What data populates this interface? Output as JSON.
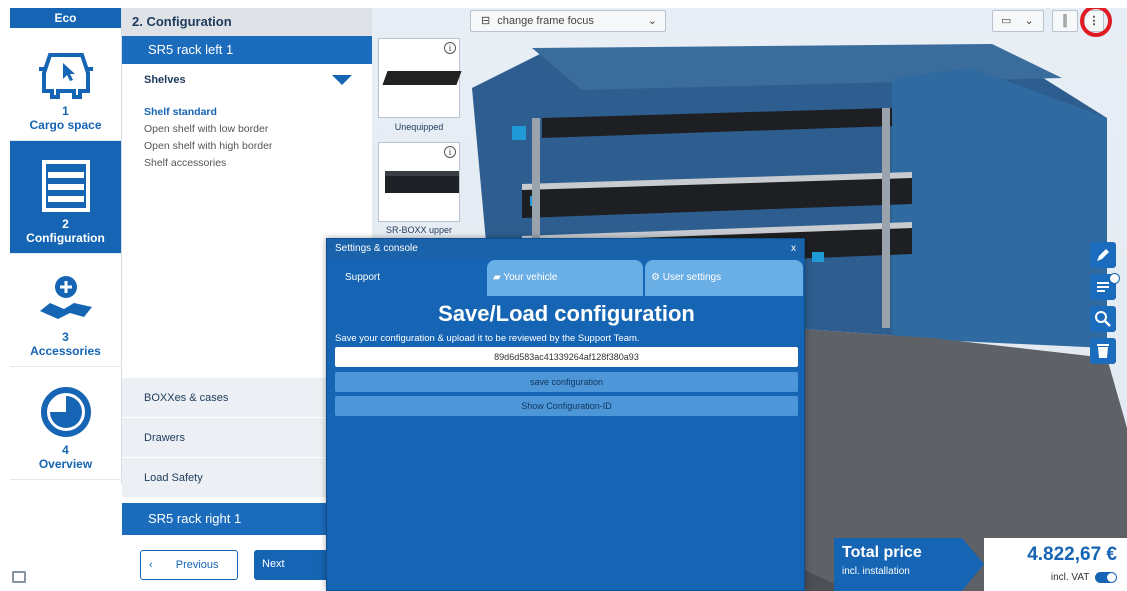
{
  "stepnav": {
    "eco": "Eco",
    "steps": [
      {
        "num": "1",
        "label": "Cargo space"
      },
      {
        "num": "2",
        "label": "Configuration"
      },
      {
        "num": "3",
        "label": "Accessories"
      },
      {
        "num": "4",
        "label": "Overview"
      }
    ]
  },
  "config": {
    "title": "2. Configuration",
    "rack_left": "SR5 rack left 1",
    "shelves_label": "Shelves",
    "options": [
      "Shelf standard",
      "Open shelf with low border",
      "Open shelf with high border",
      "Shelf accessories"
    ],
    "subcats": [
      "BOXXes & cases",
      "Drawers",
      "Load Safety"
    ],
    "rack_right": "SR5 rack right 1",
    "prev_label": "Previous",
    "prev_arrow": "‹",
    "next_label": "Next"
  },
  "thumbs": [
    "Unequipped",
    "SR-BOXX upper"
  ],
  "viewport": {
    "frame_focus": "change frame focus",
    "menu_icon": "more-vertical-icon"
  },
  "price": {
    "title": "Total price",
    "sub": "incl. installation",
    "value": "4.822,67 €",
    "vat": "incl. VAT"
  },
  "modal": {
    "title": "Settings & console",
    "close": "x",
    "tabs": [
      "Support",
      "Your vehicle",
      "User settings"
    ],
    "heading": "Save/Load configuration",
    "subtext": "Save your configuration & upload it to be reviewed by the Support Team.",
    "config_id": "89d6d583ac41339264af128f380a93",
    "save_btn": "save configuration",
    "show_btn": "Show Configuration-ID"
  },
  "colors": {
    "brand_blue": "#1565b4",
    "highlight_red": "#e01b24"
  }
}
